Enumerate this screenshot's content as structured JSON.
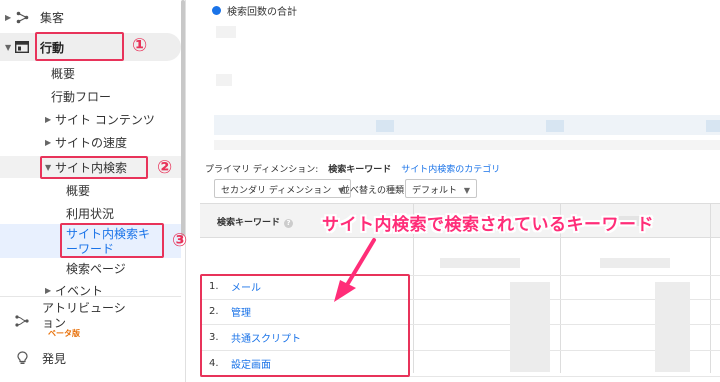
{
  "sidebar": {
    "acquisition": "集客",
    "behavior": "行動",
    "behavior_items": {
      "overview": "概要",
      "flow": "行動フロー",
      "site_content": "サイト コンテンツ",
      "site_speed": "サイトの速度",
      "site_search": "サイト内検索",
      "events": "イベント"
    },
    "site_search_items": {
      "overview": "概要",
      "usage": "利用状況",
      "search_terms": "サイト内検索キーワード",
      "search_pages": "検索ページ"
    },
    "attribution": "アトリビューション",
    "beta": "ベータ版",
    "discover": "発見"
  },
  "annotations": {
    "step1": "①",
    "step2": "②",
    "step3": "③",
    "callout": "サイト内検索で検索されているキーワード"
  },
  "chart": {
    "legend": "検索回数の合計",
    "legend_color": "#1a73e8"
  },
  "report": {
    "primary_dimension_label": "プライマリ ディメンション:",
    "primary_dimension_current": "検索キーワード",
    "primary_dimension_link": "サイト内検索のカテゴリ",
    "secondary_dimension": "セカンダリ ディメンション",
    "sort_type_label": "並べ替えの種類:",
    "sort_type_value": "デフォルト",
    "column_keyword": "検索キーワード",
    "help_icon": "?",
    "rows": [
      {
        "num": "1.",
        "keyword": "メール"
      },
      {
        "num": "2.",
        "keyword": "管理"
      },
      {
        "num": "3.",
        "keyword": "共通スクリプト"
      },
      {
        "num": "4.",
        "keyword": "設定画面"
      }
    ]
  },
  "colors": {
    "accent": "#1a73e8",
    "annotation_red": "#e8335a",
    "callout_pink": "#ff2d78"
  }
}
